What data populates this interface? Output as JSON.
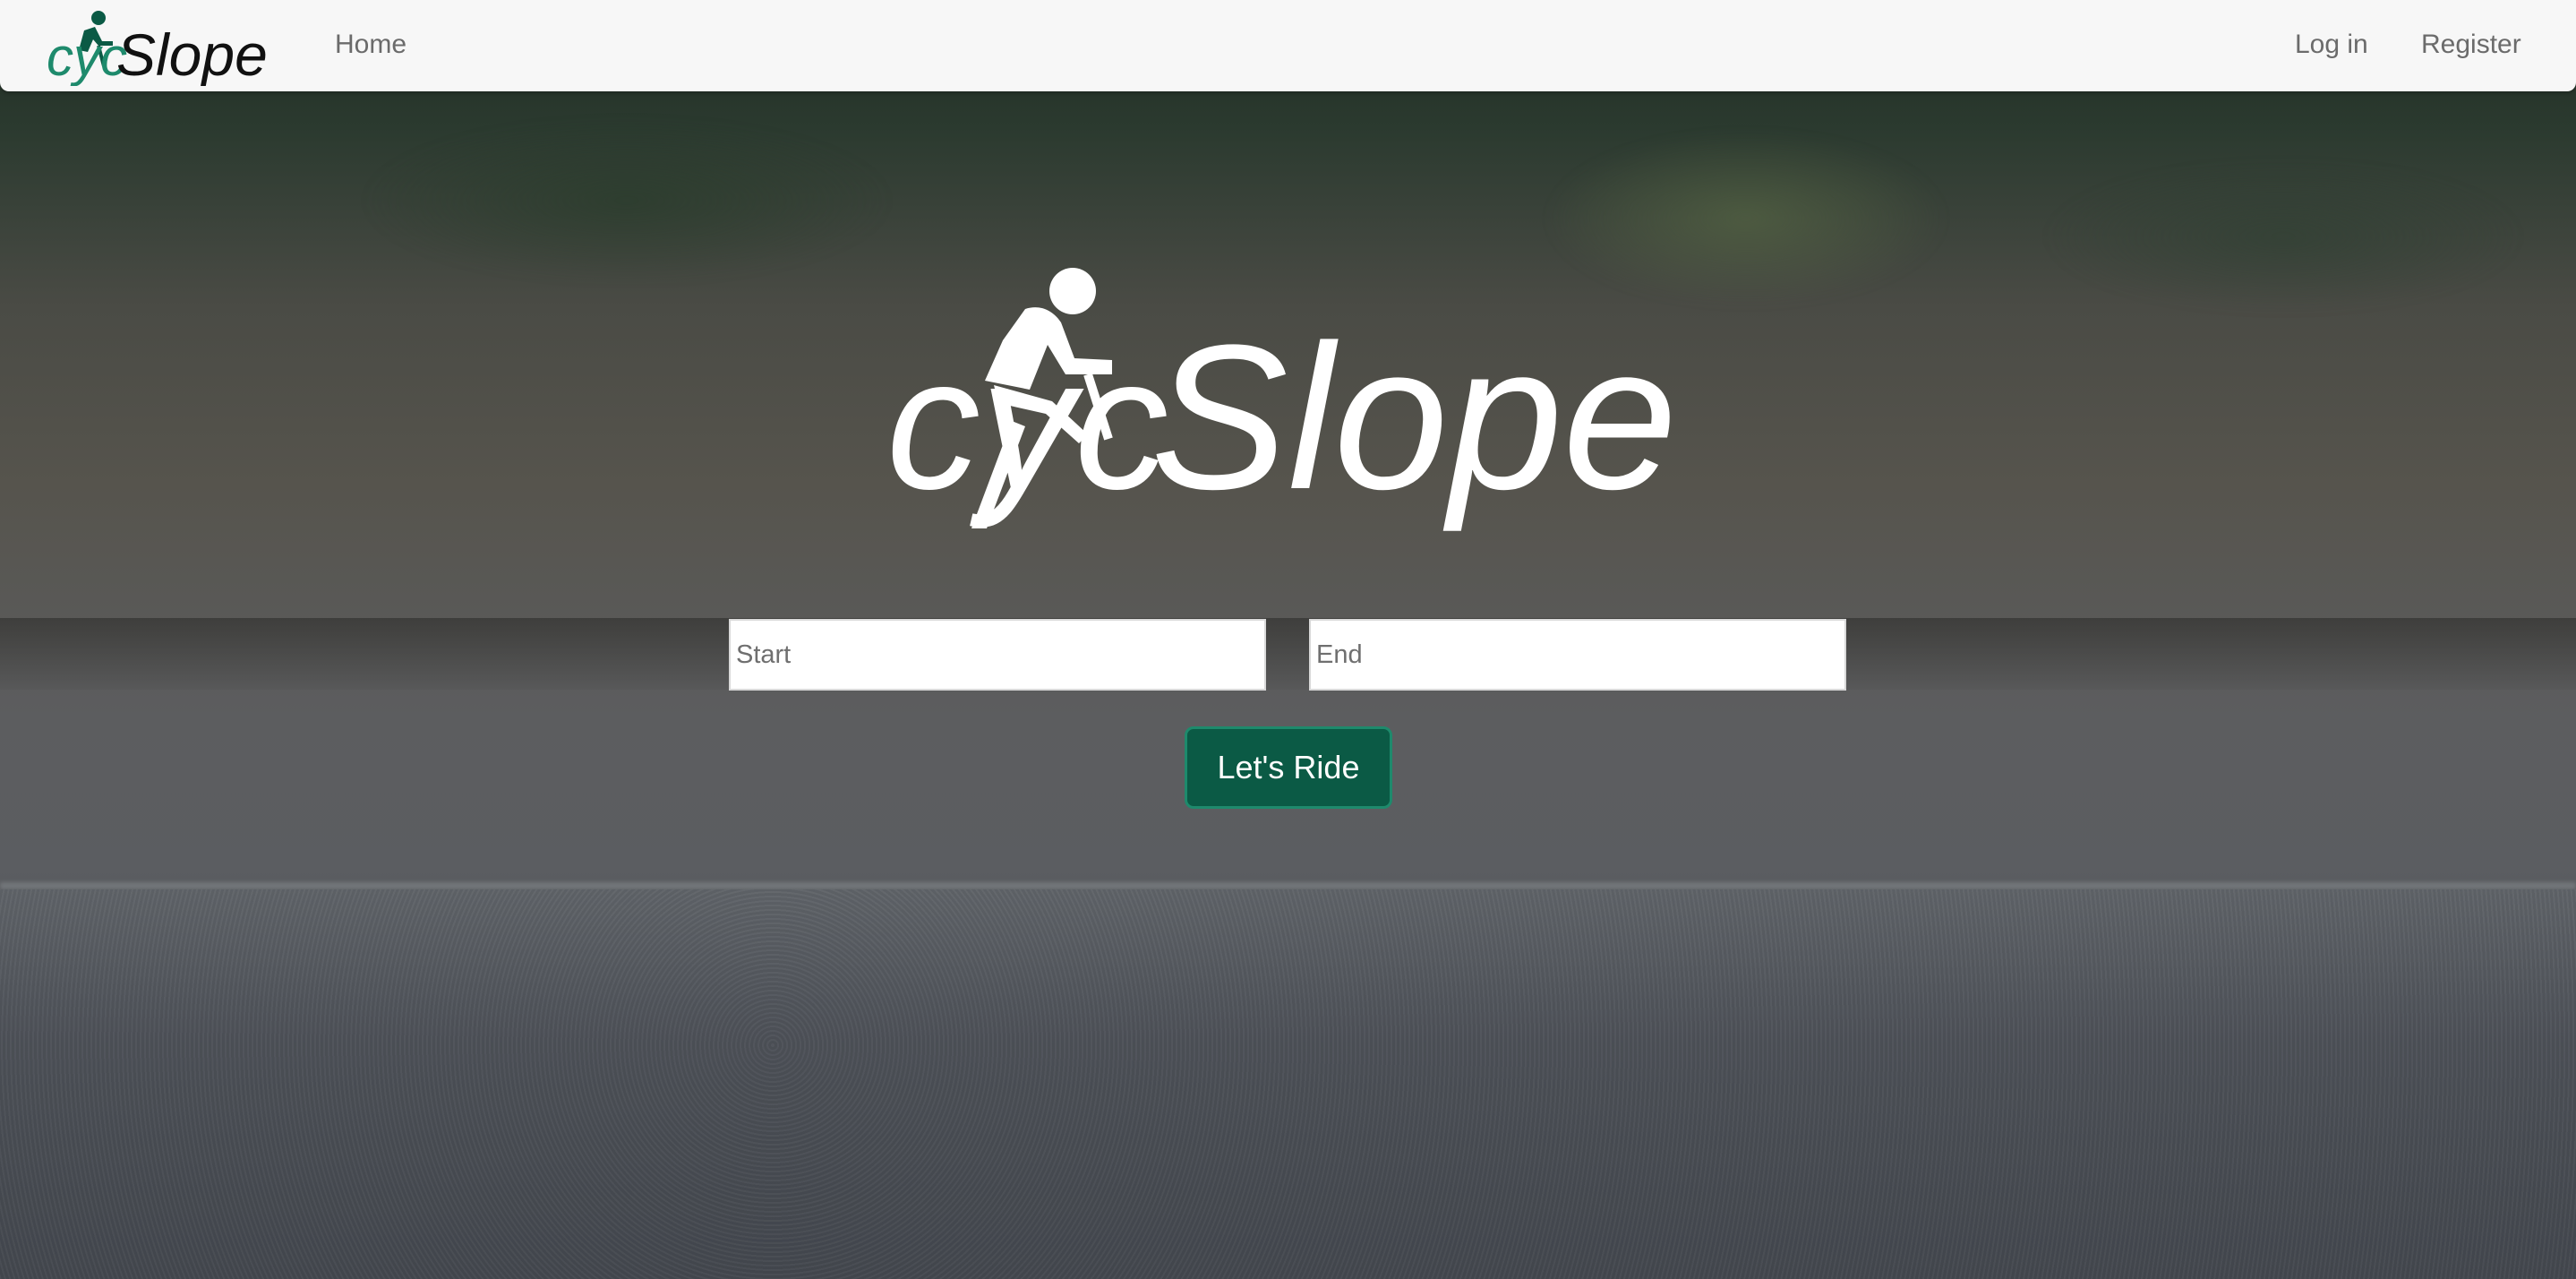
{
  "brand": {
    "prefix": "cyc",
    "suffix": "Slope",
    "accent_color": "#1e8a6c",
    "dark_green": "#0b5a45",
    "logo_icon": "cyclist-icon"
  },
  "navbar": {
    "home_label": "Home",
    "login_label": "Log in",
    "register_label": "Register"
  },
  "hero": {
    "start_placeholder": "Start",
    "end_placeholder": "End",
    "ride_button_label": "Let's Ride"
  }
}
